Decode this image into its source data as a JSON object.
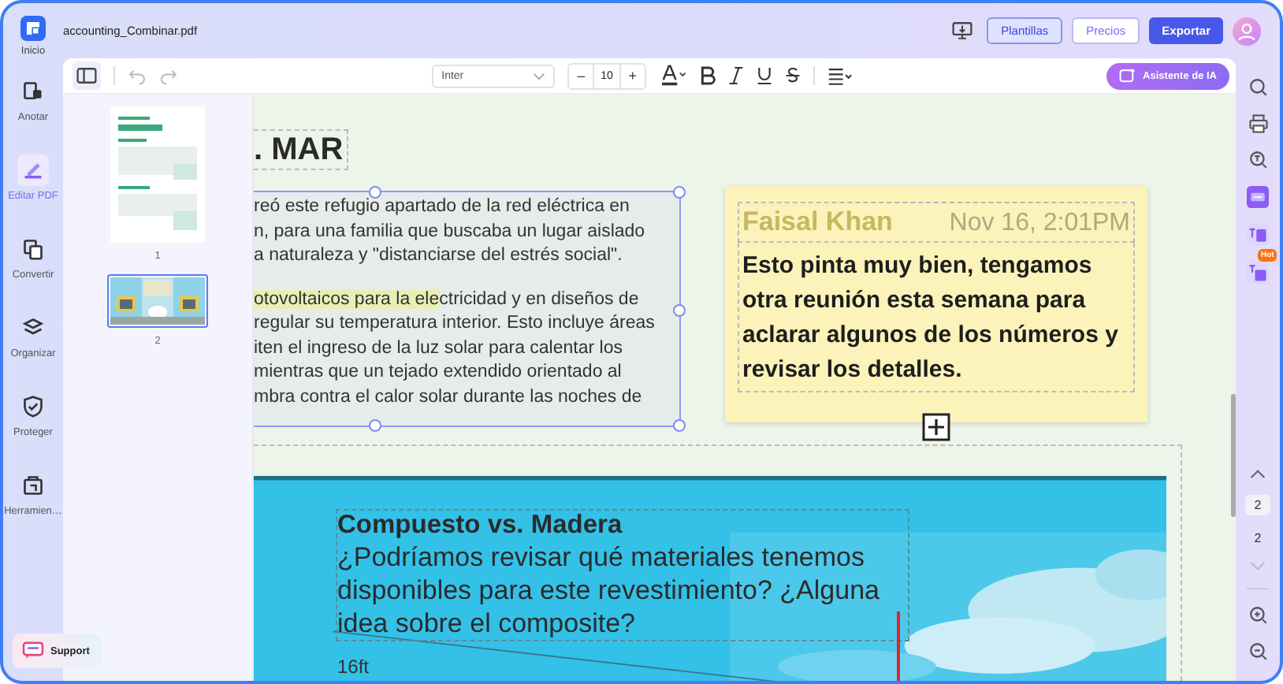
{
  "app": {
    "home_label": "Inicio",
    "file_name": "accounting_Combinar.pdf"
  },
  "header_buttons": [
    {
      "label": "Plantillas",
      "kind": "outline"
    },
    {
      "label": "Precios",
      "kind": "plain"
    },
    {
      "label": "Exportar",
      "kind": "primary"
    }
  ],
  "nav": [
    {
      "label": "Anotar",
      "selected": false
    },
    {
      "label": "Editar PDF",
      "selected": true
    },
    {
      "label": "Convertir",
      "selected": false
    },
    {
      "label": "Organizar",
      "selected": false
    },
    {
      "label": "Proteger",
      "selected": false
    },
    {
      "label": "Herramien…",
      "selected": false
    }
  ],
  "support": {
    "label": "Support"
  },
  "toolbar": {
    "font": "Inter",
    "size": "10",
    "minus": "–",
    "plus": "+",
    "ai_button": "Asistente de IA"
  },
  "thumbnails": [
    {
      "number": "1",
      "kind": "document",
      "selected": false
    },
    {
      "number": "2",
      "kind": "photos",
      "selected": true
    }
  ],
  "page": {
    "heading": ". MAR",
    "paragraph_1": [
      "reó este refugio apartado de la red eléctrica en",
      "n, para una familia que buscaba un lugar aislado",
      "a naturaleza y \"distanciarse del estrés social\"."
    ],
    "paragraph_2": [
      {
        "highlighted": "otovoltaicos para la ele",
        "text": "ctricidad y en diseños de"
      },
      {
        "text": " regular su temperatura interior. Esto incluye áreas"
      },
      {
        "text": "iten el ingreso de la luz solar para calentar los"
      },
      {
        "text": " mientras que un tejado extendido orientado al"
      },
      {
        "text": "mbra contra el calor solar durante las noches de"
      }
    ],
    "note": {
      "author": "Faisal Khan",
      "date": "Nov 16, 2:01PM",
      "body": "Esto pinta muy bien, tengamos otra reunión esta semana para aclarar algunos de los números y revisar los detalles."
    },
    "photo_comment": {
      "title": "Compuesto vs. Madera",
      "body": "¿Podríamos revisar qué materiales tenemos disponibles para este revestimiento? ¿Alguna idea sobre el composite?"
    },
    "measure": "16ft"
  },
  "right_rail": {
    "hot_badge": "Hot",
    "page_input": "2",
    "page_total": "2"
  }
}
